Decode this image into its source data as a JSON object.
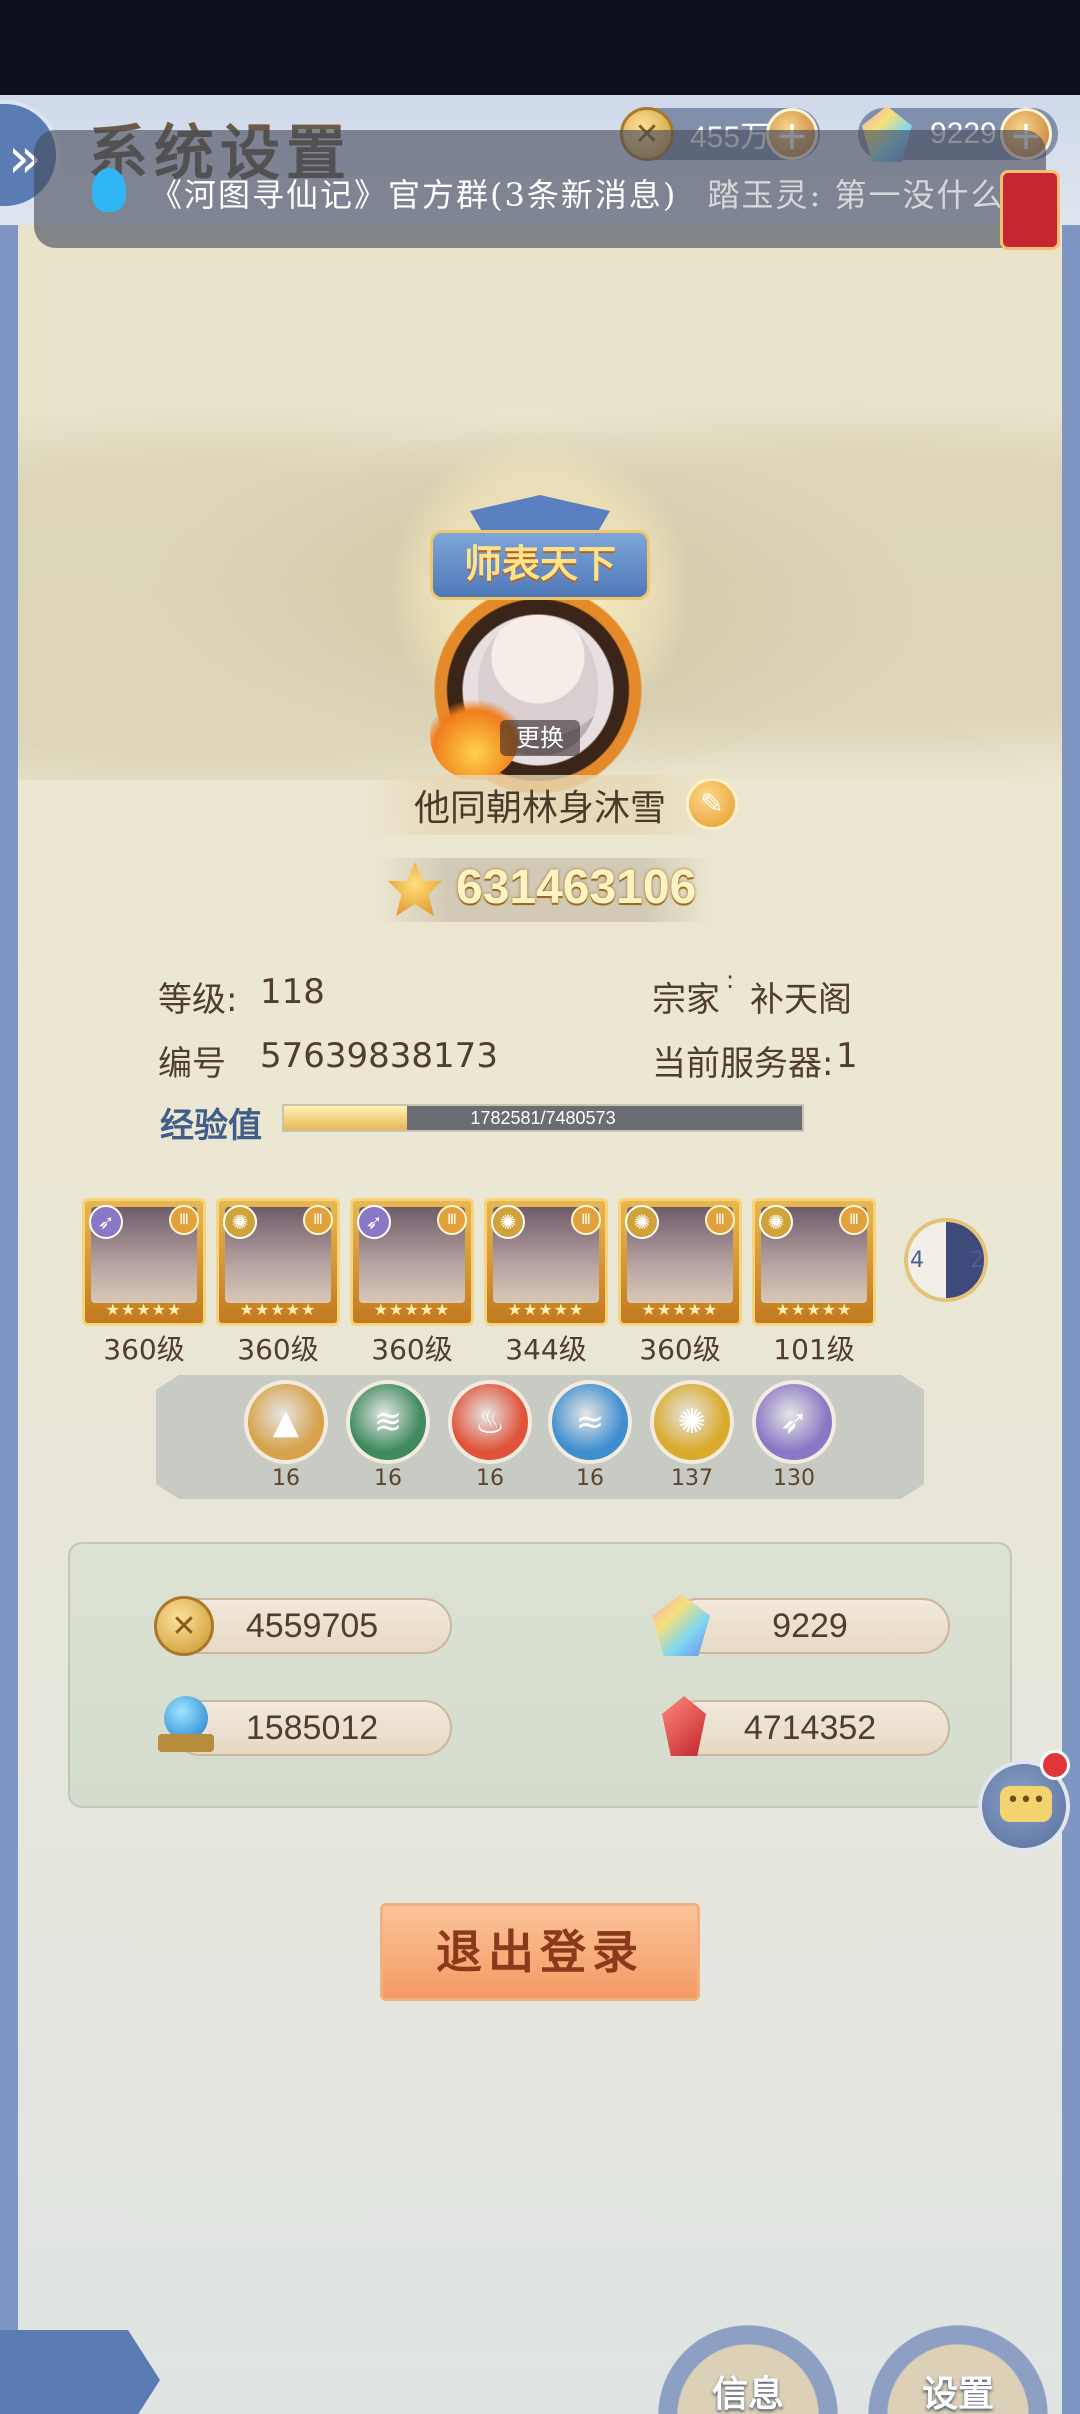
{
  "header": {
    "title": "系统设置",
    "gold": "455万",
    "gems": "9229",
    "plus_label": "+"
  },
  "notification": {
    "group": "《河图寻仙记》官方群(3条新消息)",
    "message": "踏玉灵: 第一没什么 ..."
  },
  "profile": {
    "title_badge": "师表天下",
    "swap_label": "更换",
    "name": "他同朝林身沐雪",
    "power": "631463106",
    "level_label": "等级:",
    "level_value": "118",
    "sect_label": "宗家",
    "sect_value": "补天阁",
    "id_label": "编号",
    "id_value": "57639838173",
    "server_label": "当前服务器:",
    "server_value": "1",
    "exp_label": "经验值",
    "exp_text": "1782581/7480573",
    "exp_fraction": 0.238
  },
  "heroes": [
    {
      "level": "360级",
      "element": "wind",
      "color": "#8a78c6"
    },
    {
      "level": "360级",
      "element": "sun",
      "color": "#d0a23a"
    },
    {
      "level": "360级",
      "element": "wind",
      "color": "#8a78c6"
    },
    {
      "level": "344级",
      "element": "sun",
      "color": "#d0a23a"
    },
    {
      "level": "360级",
      "element": "sun",
      "color": "#d0a23a"
    },
    {
      "level": "101级",
      "element": "sun",
      "color": "#d0a23a"
    }
  ],
  "yinyang": {
    "left": "4",
    "right": "2"
  },
  "elements": [
    {
      "icon": "mountain-icon",
      "count": "16",
      "color": "#d7a24c"
    },
    {
      "icon": "tornado-icon",
      "count": "16",
      "color": "#3f8a5f"
    },
    {
      "icon": "fire-icon",
      "count": "16",
      "color": "#e0533a"
    },
    {
      "icon": "water-icon",
      "count": "16",
      "color": "#3f8fd0"
    },
    {
      "icon": "sun-icon",
      "count": "137",
      "color": "#d9aa2c"
    },
    {
      "icon": "wind-icon",
      "count": "130",
      "color": "#8a78c6"
    }
  ],
  "resources": {
    "gold": "4559705",
    "gems": "9229",
    "orb": "1585012",
    "crystal": "4714352"
  },
  "logout_label": "退出登录",
  "bottom_nav": {
    "info": "信息",
    "settings": "设置"
  },
  "colors": {
    "frame": "#7f95c2",
    "accent_gold": "#e5b85a",
    "logout": "#f39a63"
  }
}
